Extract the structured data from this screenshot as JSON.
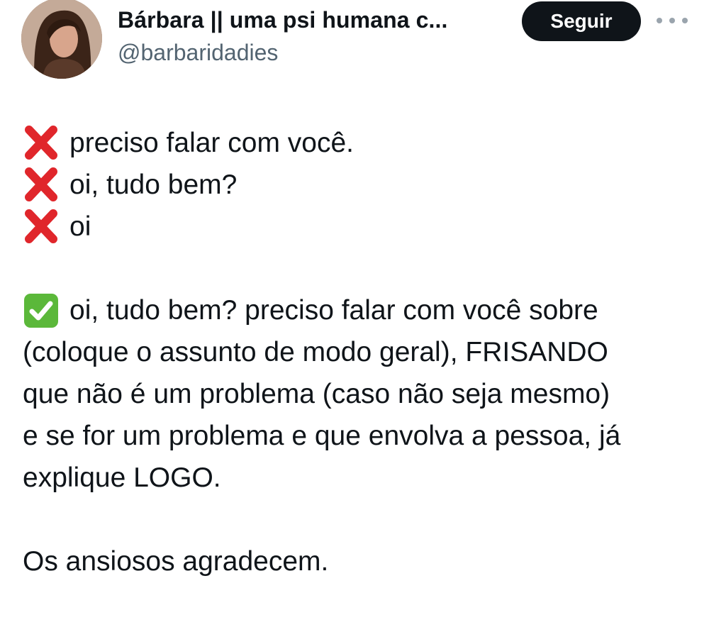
{
  "author": {
    "display_name": "Bárbara || uma psi humana c...",
    "handle": "@barbaridadies",
    "avatar_icon": "profile-photo-avatar"
  },
  "actions": {
    "follow_label": "Seguir",
    "more_icon": "more-options-icon"
  },
  "tweet": {
    "wrong_examples": [
      {
        "icon": "red-cross-mark-icon",
        "text": "preciso falar com você."
      },
      {
        "icon": "red-cross-mark-icon",
        "text": "oi, tudo bem?"
      },
      {
        "icon": "red-cross-mark-icon",
        "text": "oi"
      }
    ],
    "right_example": {
      "icon": "green-check-mark-icon",
      "lines": [
        "oi, tudo bem? preciso falar com você sobre",
        "(coloque o assunto de modo geral), FRISANDO",
        "que não é um problema (caso não seja mesmo)",
        "e se for um problema e que envolva a pessoa, já",
        "explique LOGO."
      ]
    },
    "closing": "Os ansiosos agradecem."
  },
  "colors": {
    "text": "#0f1419",
    "secondary_text": "#536471",
    "follow_button_bg": "#0f1419",
    "cross_red": "#e0262b",
    "check_green": "#5bb83a"
  }
}
